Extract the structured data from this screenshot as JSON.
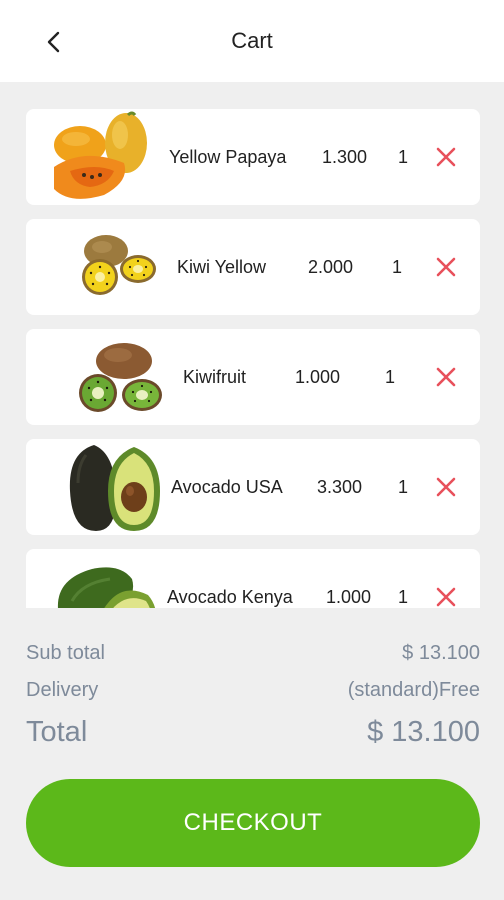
{
  "header": {
    "title": "Cart",
    "back_icon": "chevron-left-icon"
  },
  "cart": {
    "remove_icon": "close-icon",
    "remove_color": "#e8505b",
    "items": [
      {
        "name": "Yellow Papaya",
        "price": "1.300",
        "qty": "1",
        "image": "papaya-image"
      },
      {
        "name": "Kiwi Yellow",
        "price": "2.000",
        "qty": "1",
        "image": "yellow-kiwi-image"
      },
      {
        "name": "Kiwifruit",
        "price": "1.000",
        "qty": "1",
        "image": "kiwifruit-image"
      },
      {
        "name": "Avocado USA",
        "price": "3.300",
        "qty": "1",
        "image": "avocado-usa-image"
      },
      {
        "name": "Avocado Kenya",
        "price": "1.000",
        "qty": "1",
        "image": "avocado-kenya-image"
      }
    ]
  },
  "summary": {
    "subtotal_label": "Sub total",
    "subtotal_value": "$ 13.100",
    "delivery_label": "Delivery",
    "delivery_value": "(standard)Free",
    "total_label": "Total",
    "total_value": "$ 13.100"
  },
  "checkout": {
    "label": "CHECKOUT",
    "color": "#5cb81a"
  }
}
